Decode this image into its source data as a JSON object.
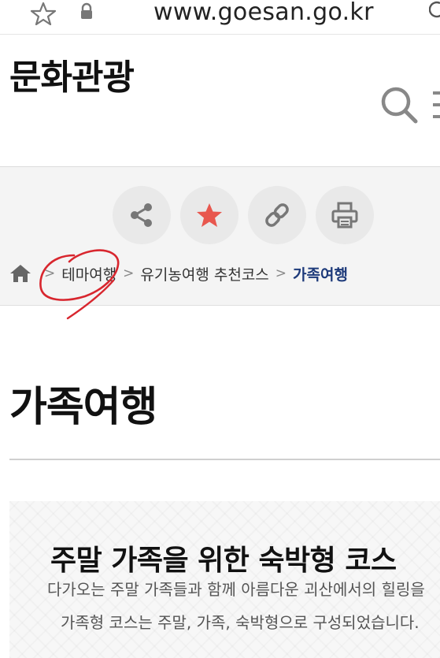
{
  "browser": {
    "url": "www.goesan.go.kr"
  },
  "header": {
    "site_title": "문화관광"
  },
  "toolbar": {
    "buttons": [
      "share-icon",
      "star-icon",
      "link-icon",
      "print-icon"
    ],
    "star_color": "#e8574e"
  },
  "breadcrumb": {
    "items": [
      "테마여행",
      "유기농여행 추천코스",
      "가족여행"
    ],
    "separator": ">"
  },
  "page": {
    "heading": "가족여행"
  },
  "content": {
    "title": "주말 가족을 위한 숙박형 코스",
    "line1": "다가오는 주말 가족들과 함께 아름다운 괴산에서의 힐링을",
    "line2": "가족형 코스는 주말, 가족, 숙박형으로 구성되었습니다."
  },
  "colors": {
    "accent": "#1d3a7a",
    "annotation": "#d8262e"
  }
}
